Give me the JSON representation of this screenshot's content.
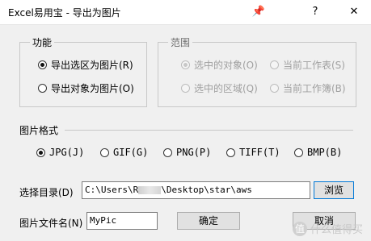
{
  "window": {
    "title": "Excel易用宝 - 导出为图片",
    "pin_label": "📌",
    "help_label": "?",
    "close_label": "✕"
  },
  "function_group": {
    "title": "功能",
    "options": [
      {
        "label": "导出选区为图片(R)",
        "checked": true
      },
      {
        "label": "导出对象为图片(O)",
        "checked": false
      }
    ]
  },
  "range_group": {
    "title": "范围",
    "options": [
      {
        "label": "选中的对象(O)",
        "checked": true
      },
      {
        "label": "当前工作表(S)",
        "checked": false
      },
      {
        "label": "选中的区域(Q)",
        "checked": false
      },
      {
        "label": "当前工作簿(B)",
        "checked": false
      }
    ]
  },
  "format": {
    "title": "图片格式",
    "options": [
      {
        "label": "JPG(J)",
        "checked": true
      },
      {
        "label": "GIF(G)",
        "checked": false
      },
      {
        "label": "PNG(P)",
        "checked": false
      },
      {
        "label": "TIFF(T)",
        "checked": false
      },
      {
        "label": "BMP(B)",
        "checked": false
      }
    ]
  },
  "directory": {
    "label": "选择目录(D)",
    "value_start": "C:\\Users\\R",
    "value_end": "\\Desktop\\star\\aws",
    "browse_label": "浏览"
  },
  "filename": {
    "label": "图片文件名(N)",
    "value": "MyPic"
  },
  "actions": {
    "ok_label": "确定",
    "cancel_label": "取消"
  },
  "watermark": {
    "icon": "值",
    "text": "什么值得买"
  }
}
